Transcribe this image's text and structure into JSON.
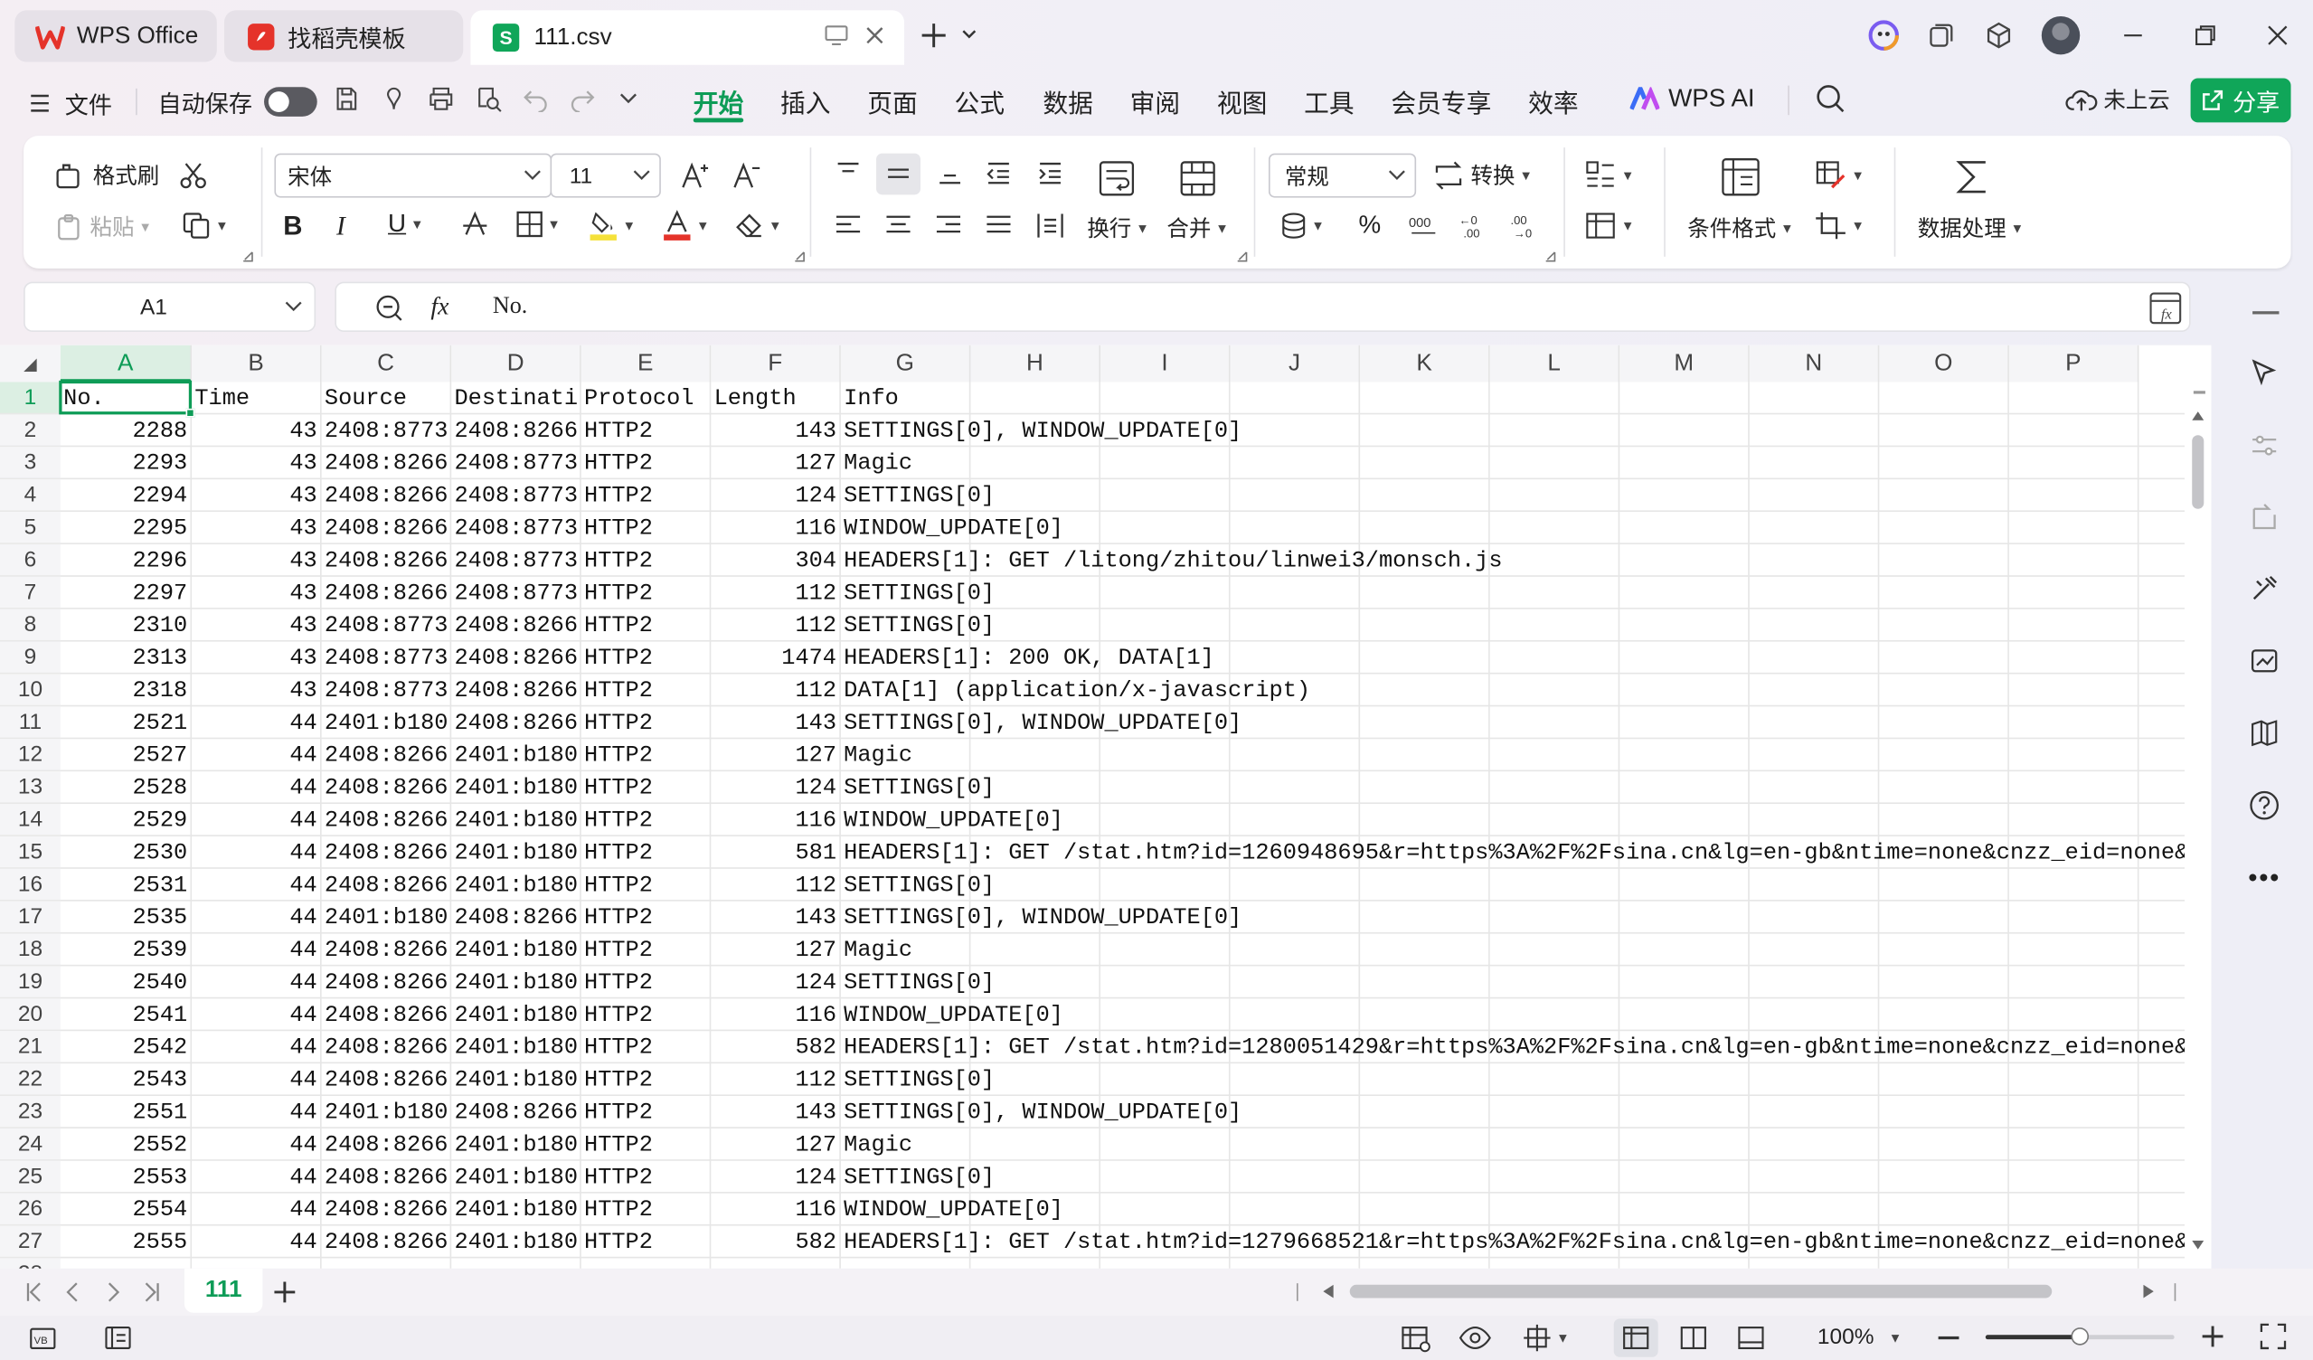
{
  "tabs": [
    {
      "label": "WPS Office"
    },
    {
      "label": "找稻壳模板"
    },
    {
      "label": "111.csv"
    }
  ],
  "menu": {
    "file": "文件",
    "autosave": "自动保存",
    "items": [
      "开始",
      "插入",
      "页面",
      "公式",
      "数据",
      "审阅",
      "视图",
      "工具",
      "会员专享",
      "效率"
    ],
    "ai": "WPS AI",
    "cloud": "未上云",
    "share": "分享"
  },
  "ribbon": {
    "format_painter": "格式刷",
    "paste": "粘贴",
    "font_name": "宋体",
    "font_size": "11",
    "wrap": "换行",
    "merge": "合并",
    "number_format": "常规",
    "convert": "转换",
    "cond_format": "条件格式",
    "data_process": "数据处理"
  },
  "formula": {
    "cell_ref": "A1",
    "fx": "fx",
    "content": "No."
  },
  "grid": {
    "columns": [
      "A",
      "B",
      "C",
      "D",
      "E",
      "F",
      "G",
      "H",
      "I",
      "J",
      "K",
      "L",
      "M",
      "N",
      "O",
      "P"
    ],
    "selected_column": "A",
    "header_row": [
      "No.",
      "Time",
      "Source",
      "Destinati",
      "Protocol",
      "Length",
      "Info"
    ],
    "rows": [
      [
        "2288",
        "43",
        "2408:8773",
        "2408:8266",
        "HTTP2",
        "143",
        "SETTINGS[0], WINDOW_UPDATE[0]"
      ],
      [
        "2293",
        "43",
        "2408:8266",
        "2408:8773",
        "HTTP2",
        "127",
        "Magic"
      ],
      [
        "2294",
        "43",
        "2408:8266",
        "2408:8773",
        "HTTP2",
        "124",
        "SETTINGS[0]"
      ],
      [
        "2295",
        "43",
        "2408:8266",
        "2408:8773",
        "HTTP2",
        "116",
        "WINDOW_UPDATE[0]"
      ],
      [
        "2296",
        "43",
        "2408:8266",
        "2408:8773",
        "HTTP2",
        "304",
        "HEADERS[1]: GET /litong/zhitou/linwei3/monsch.js"
      ],
      [
        "2297",
        "43",
        "2408:8266",
        "2408:8773",
        "HTTP2",
        "112",
        "SETTINGS[0]"
      ],
      [
        "2310",
        "43",
        "2408:8773",
        "2408:8266",
        "HTTP2",
        "112",
        "SETTINGS[0]"
      ],
      [
        "2313",
        "43",
        "2408:8773",
        "2408:8266",
        "HTTP2",
        "1474",
        "HEADERS[1]: 200 OK, DATA[1]"
      ],
      [
        "2318",
        "43",
        "2408:8773",
        "2408:8266",
        "HTTP2",
        "112",
        "DATA[1] (application/x-javascript)"
      ],
      [
        "2521",
        "44",
        "2401:b180",
        "2408:8266",
        "HTTP2",
        "143",
        "SETTINGS[0], WINDOW_UPDATE[0]"
      ],
      [
        "2527",
        "44",
        "2408:8266",
        "2401:b180",
        "HTTP2",
        "127",
        "Magic"
      ],
      [
        "2528",
        "44",
        "2408:8266",
        "2401:b180",
        "HTTP2",
        "124",
        "SETTINGS[0]"
      ],
      [
        "2529",
        "44",
        "2408:8266",
        "2401:b180",
        "HTTP2",
        "116",
        "WINDOW_UPDATE[0]"
      ],
      [
        "2530",
        "44",
        "2408:8266",
        "2401:b180",
        "HTTP2",
        "581",
        "HEADERS[1]: GET /stat.htm?id=1260948695&r=https%3A%2F%2Fsina.cn&lg=en-gb&ntime=none&cnzz_eid=none&"
      ],
      [
        "2531",
        "44",
        "2408:8266",
        "2401:b180",
        "HTTP2",
        "112",
        "SETTINGS[0]"
      ],
      [
        "2535",
        "44",
        "2401:b180",
        "2408:8266",
        "HTTP2",
        "143",
        "SETTINGS[0], WINDOW_UPDATE[0]"
      ],
      [
        "2539",
        "44",
        "2408:8266",
        "2401:b180",
        "HTTP2",
        "127",
        "Magic"
      ],
      [
        "2540",
        "44",
        "2408:8266",
        "2401:b180",
        "HTTP2",
        "124",
        "SETTINGS[0]"
      ],
      [
        "2541",
        "44",
        "2408:8266",
        "2401:b180",
        "HTTP2",
        "116",
        "WINDOW_UPDATE[0]"
      ],
      [
        "2542",
        "44",
        "2408:8266",
        "2401:b180",
        "HTTP2",
        "582",
        "HEADERS[1]: GET /stat.htm?id=1280051429&r=https%3A%2F%2Fsina.cn&lg=en-gb&ntime=none&cnzz_eid=none&"
      ],
      [
        "2543",
        "44",
        "2408:8266",
        "2401:b180",
        "HTTP2",
        "112",
        "SETTINGS[0]"
      ],
      [
        "2551",
        "44",
        "2401:b180",
        "2408:8266",
        "HTTP2",
        "143",
        "SETTINGS[0], WINDOW_UPDATE[0]"
      ],
      [
        "2552",
        "44",
        "2408:8266",
        "2401:b180",
        "HTTP2",
        "127",
        "Magic"
      ],
      [
        "2553",
        "44",
        "2408:8266",
        "2401:b180",
        "HTTP2",
        "124",
        "SETTINGS[0]"
      ],
      [
        "2554",
        "44",
        "2408:8266",
        "2401:b180",
        "HTTP2",
        "116",
        "WINDOW_UPDATE[0]"
      ],
      [
        "2555",
        "44",
        "2408:8266",
        "2401:b180",
        "HTTP2",
        "582",
        "HEADERS[1]: GET /stat.htm?id=1279668521&r=https%3A%2F%2Fsina.cn&lg=en-gb&ntime=none&cnzz_eid=none&"
      ]
    ]
  },
  "sheet_tab": "111",
  "status": {
    "zoom": "100%",
    "zoom_level": 1.0
  },
  "colors": {
    "accent": "#0e9c57",
    "share_button": "#10a659",
    "wps_red": "#e5332a"
  }
}
